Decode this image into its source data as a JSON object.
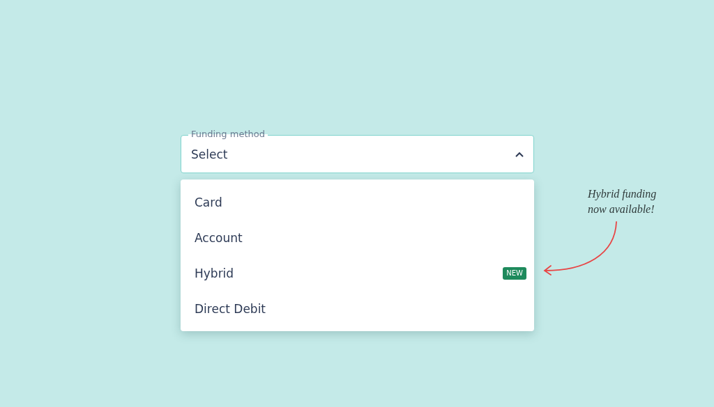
{
  "select": {
    "label": "Funding method",
    "value": "Select",
    "expanded": true,
    "options": [
      {
        "label": "Card"
      },
      {
        "label": "Account"
      },
      {
        "label": "Hybrid",
        "badge": "NEW"
      },
      {
        "label": "Direct Debit"
      }
    ]
  },
  "annotation": {
    "text": "Hybrid funding now available!"
  }
}
